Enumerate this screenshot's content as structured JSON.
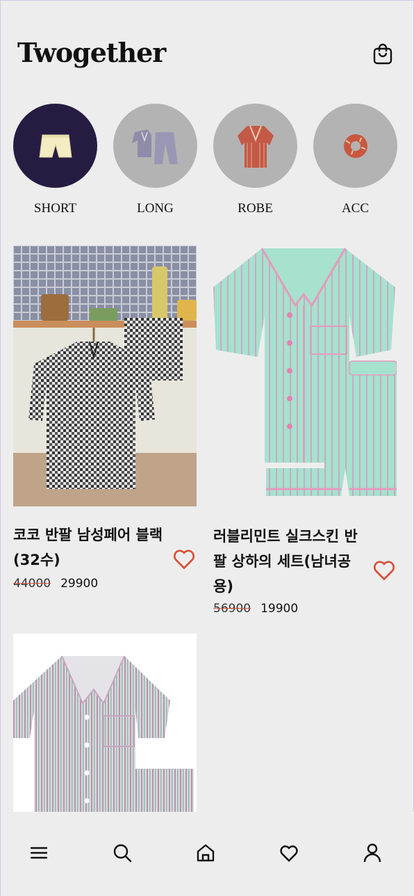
{
  "app": {
    "title": "Twogether"
  },
  "header": {
    "cart_icon": "shopping-bag-icon"
  },
  "categories": [
    {
      "label": "SHORT",
      "active": true
    },
    {
      "label": "LONG",
      "active": false
    },
    {
      "label": "ROBE",
      "active": false
    },
    {
      "label": "ACC",
      "active": false
    }
  ],
  "products": [
    {
      "name_line1": "코코 반팔 남성페어 블랙",
      "name_line2": "(32수)",
      "name_line3": "",
      "old_price": "44000",
      "price": "29900"
    },
    {
      "name_line1": "러블리민트 실크스킨 반",
      "name_line2": "팔 상하의 세트(남녀공",
      "name_line3": "용)",
      "old_price": "56900",
      "price": "19900"
    },
    {
      "name_line1": "",
      "name_line2": "",
      "name_line3": "",
      "old_price": "",
      "price": ""
    }
  ],
  "colors": {
    "accent": "#d8503a",
    "active_category": "#261c42",
    "inactive_category": "#b3b3b3",
    "background": "#ededed"
  },
  "bottom_nav": [
    {
      "icon": "menu-icon"
    },
    {
      "icon": "search-icon"
    },
    {
      "icon": "home-icon"
    },
    {
      "icon": "heart-icon"
    },
    {
      "icon": "user-icon"
    }
  ]
}
